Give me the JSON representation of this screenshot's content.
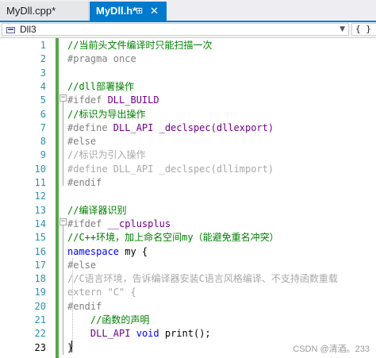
{
  "tabs": [
    {
      "label": "MyDll.cpp*"
    },
    {
      "label": "MyDll.h*",
      "pin": "⊞",
      "close": "✕"
    }
  ],
  "navbar": {
    "project": "Dll3",
    "scope": "{ } m"
  },
  "lines": [
    {
      "n": "1",
      "tokens": [
        {
          "t": "//当前头文件编译时只能扫描一次",
          "c": "cm"
        }
      ]
    },
    {
      "n": "2",
      "tokens": [
        {
          "t": "#pragma once",
          "c": "pp"
        }
      ]
    },
    {
      "n": "3",
      "tokens": []
    },
    {
      "n": "4",
      "tokens": [
        {
          "t": "//dll部署操作",
          "c": "cm"
        }
      ]
    },
    {
      "n": "5",
      "tokens": [
        {
          "t": "#ifdef ",
          "c": "pp"
        },
        {
          "t": "DLL_BUILD",
          "c": "mac"
        }
      ]
    },
    {
      "n": "6",
      "tokens": [
        {
          "t": "//标识为导出操作",
          "c": "cm"
        }
      ]
    },
    {
      "n": "7",
      "tokens": [
        {
          "t": "#define ",
          "c": "pp"
        },
        {
          "t": "DLL_API _declspec(dllexport)",
          "c": "mac"
        }
      ]
    },
    {
      "n": "8",
      "tokens": [
        {
          "t": "#else",
          "c": "pp"
        }
      ]
    },
    {
      "n": "9",
      "tokens": [
        {
          "t": "//标识为引入操作",
          "c": "grey"
        }
      ]
    },
    {
      "n": "10",
      "tokens": [
        {
          "t": "#define DLL_API _declspec(dllimport)",
          "c": "grey"
        }
      ]
    },
    {
      "n": "11",
      "tokens": [
        {
          "t": "#endif",
          "c": "pp"
        }
      ]
    },
    {
      "n": "12",
      "tokens": []
    },
    {
      "n": "13",
      "tokens": [
        {
          "t": "//编译器识别",
          "c": "cm"
        }
      ]
    },
    {
      "n": "14",
      "tokens": [
        {
          "t": "#ifdef ",
          "c": "pp"
        },
        {
          "t": "__cplusplus",
          "c": "mac"
        }
      ]
    },
    {
      "n": "15",
      "tokens": [
        {
          "t": "//C++环境，加上命名空间my（能避免重名冲突）",
          "c": "cm"
        }
      ]
    },
    {
      "n": "16",
      "tokens": [
        {
          "t": "namespace",
          "c": "kw"
        },
        {
          "t": " my {",
          "c": ""
        }
      ]
    },
    {
      "n": "17",
      "tokens": [
        {
          "t": "#else",
          "c": "pp"
        }
      ]
    },
    {
      "n": "18",
      "tokens": [
        {
          "t": "//C语言环境，告诉编译器安装C语言风格编译、不支持函数重载",
          "c": "grey"
        }
      ]
    },
    {
      "n": "19",
      "tokens": [
        {
          "t": "extern \"C\" {",
          "c": "grey"
        }
      ]
    },
    {
      "n": "20",
      "tokens": [
        {
          "t": "#endif",
          "c": "pp"
        }
      ]
    },
    {
      "n": "21",
      "tokens": [
        {
          "t": "    //函数的声明",
          "c": "cm"
        }
      ]
    },
    {
      "n": "22",
      "tokens": [
        {
          "t": "    ",
          "c": ""
        },
        {
          "t": "DLL_API",
          "c": "mac"
        },
        {
          "t": " ",
          "c": ""
        },
        {
          "t": "void",
          "c": "kw"
        },
        {
          "t": " print();",
          "c": ""
        }
      ]
    },
    {
      "n": "23",
      "tokens": [
        {
          "t": "}",
          "c": ""
        }
      ]
    }
  ],
  "current_line": "23",
  "watermark": "CSDN @清酒。233"
}
